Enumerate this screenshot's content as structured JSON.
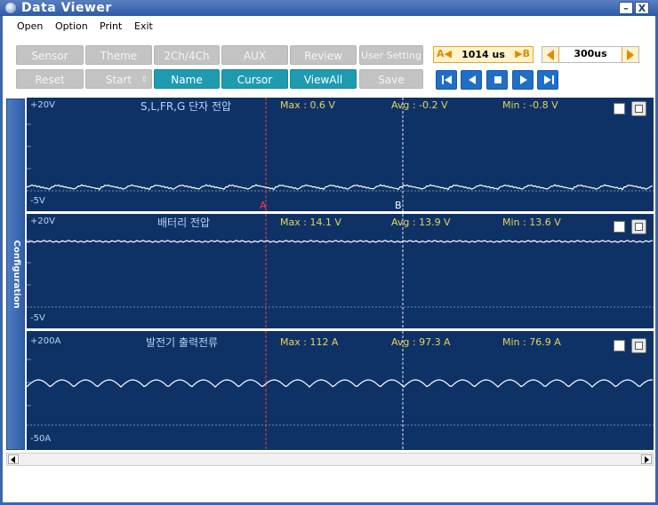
{
  "window": {
    "title": "Data Viewer",
    "minimize_label": "–",
    "close_label": "X"
  },
  "menu": {
    "items": [
      "Open",
      "Option",
      "Print",
      "Exit"
    ]
  },
  "toolbar": {
    "row1": [
      "Sensor",
      "Theme",
      "2Ch/4Ch",
      "AUX",
      "Review",
      "User Setting"
    ],
    "row2": [
      "Reset",
      "Start",
      "Name",
      "Cursor",
      "ViewAll",
      "Save"
    ],
    "start_spinner": "⇕",
    "cursor": {
      "a_label": "A◀",
      "b_label": "▶B",
      "value": "1014 us"
    },
    "timebase": {
      "value": "300us"
    },
    "playback_icons": [
      "skip-to-start-icon",
      "step-back-icon",
      "stop-icon",
      "play-icon",
      "skip-to-end-icon"
    ]
  },
  "sidebar": {
    "label": "Configuration"
  },
  "colors": {
    "panel_bg": "#0f3266",
    "trace": "#ffffff",
    "stat_text": "#e8d25a",
    "scale_text": "#b7d3f3",
    "teal_button": "#1e9bb0",
    "gray_button": "#c3c3c3",
    "cursor_a": "#ff3b3b",
    "cursor_b": "#ffffff"
  },
  "channels": [
    {
      "top": "+20V",
      "bottom": "-5V",
      "title": "S,L,FR,G 단자 전압",
      "max": "Max : 0.6 V",
      "avg": "Avg : -0.2 V",
      "min": "Min : -0.8 V",
      "cursor_a_label": "A",
      "cursor_b_label": "B"
    },
    {
      "top": "+20V",
      "bottom": "-5V",
      "title": "배터리 전압",
      "max": "Max : 14.1 V",
      "avg": "Avg : 13.9 V",
      "min": "Min : 13.6 V"
    },
    {
      "top": "+200A",
      "bottom": "-50A",
      "title": "발전기 출력전류",
      "max": "Max : 112 A",
      "avg": "Avg : 97.3 A",
      "min": "Min : 76.9 A"
    }
  ]
}
